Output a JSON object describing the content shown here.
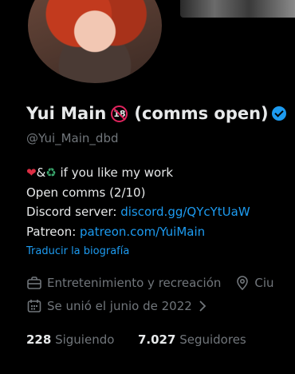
{
  "profile": {
    "display_name": "Yui Main",
    "age_badge": "18",
    "name_suffix": "(comms open)",
    "handle": "@Yui_Main_dbd"
  },
  "bio": {
    "line1_emoji_heart": "❤",
    "line1_amp": "&",
    "line1_emoji_recycle": "♻",
    "line1_text": " if you like my work",
    "line2": "Open comms (2/10)",
    "line3_label": "Discord server: ",
    "line3_link": "discord.gg/QYcYtUaW",
    "line4_label": "Patreon: ",
    "line4_link": "patreon.com/YuiMain",
    "translate": "Traducir la biografía"
  },
  "meta": {
    "category": "Entretenimiento y recreación",
    "location_partial": "Ciu",
    "joined": "Se unió el junio de 2022"
  },
  "stats": {
    "following_count": "228",
    "following_label": "Siguiendo",
    "followers_count": "7.027",
    "followers_label": "Seguidores"
  },
  "colors": {
    "background": "#000000",
    "link": "#1d9bf0",
    "muted": "#71767b",
    "text": "#e7e9ea"
  }
}
